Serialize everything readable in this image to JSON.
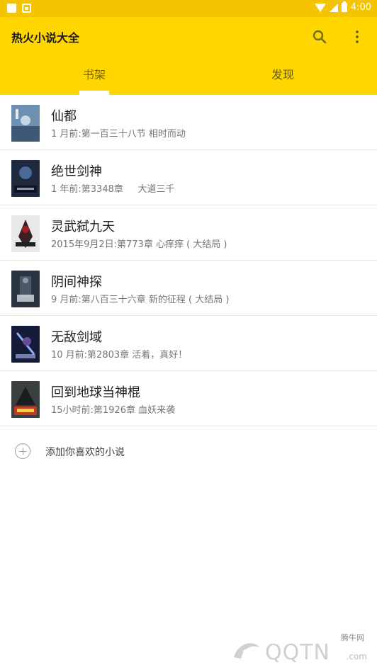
{
  "status_bar": {
    "time": "4:00"
  },
  "app": {
    "title": "热火小说大全"
  },
  "tabs": [
    {
      "label": "书架",
      "active": true
    },
    {
      "label": "发现",
      "active": false
    }
  ],
  "books": [
    {
      "title": "仙都",
      "subtitle": "1 月前:第一百三十八节 相时而动",
      "cover_color": "#4a6a8a"
    },
    {
      "title": "绝世剑神",
      "subtitle": "1 年前:第3348章     大道三千",
      "cover_color": "#1f2a40"
    },
    {
      "title": "灵武弑九天",
      "subtitle": "2015年9月2日:第773章 心痒痒 ( 大结局 )",
      "cover_color": "#3a2a2a"
    },
    {
      "title": "阴间神探",
      "subtitle": "9 月前:第八百三十六章 新的征程 ( 大结局 )",
      "cover_color": "#2a3440"
    },
    {
      "title": "无敌剑域",
      "subtitle": "10 月前:第2803章 活着，真好！",
      "cover_color": "#1a2240"
    },
    {
      "title": "回到地球当神棍",
      "subtitle": "15小时前:第1926章 血妖来袭",
      "cover_color": "#2a3030"
    }
  ],
  "add_row": {
    "label": "添加你喜欢的小说"
  },
  "watermark": {
    "brand": "腾牛网",
    "main": "QQTN",
    "domain": ".com"
  },
  "colors": {
    "appbar": "#ffd600",
    "status": "#f5c400",
    "text_primary": "#212121",
    "text_secondary": "#757575"
  }
}
